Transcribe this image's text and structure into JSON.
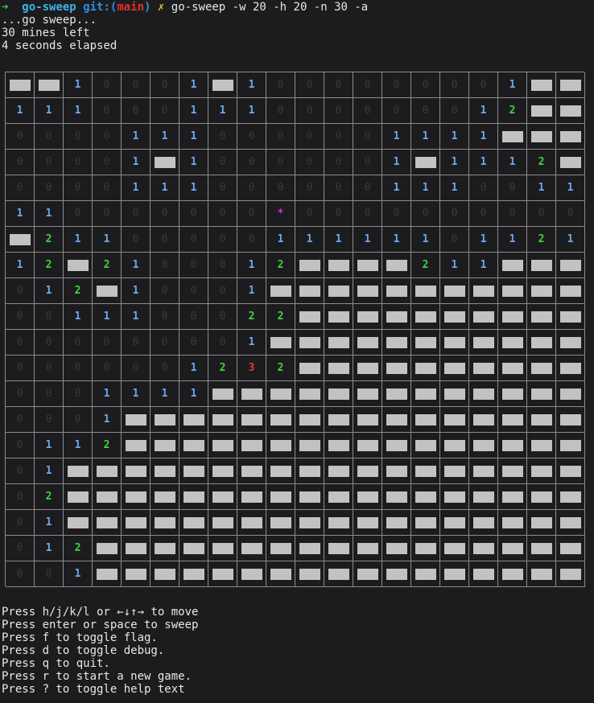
{
  "prompt": {
    "arrow": "➜",
    "directory": "go-sweep",
    "git_prefix": "git:(",
    "branch": "main",
    "git_suffix": ")",
    "dirty_mark": "✗",
    "command": "go-sweep -w 20 -h 20 -n 30 -a"
  },
  "status": {
    "title": "...go sweep...",
    "mines_left": "30 mines left",
    "elapsed": "4 seconds elapsed"
  },
  "board": {
    "width": 20,
    "height": 20,
    "legend": "# = covered cell, * = mine, digits = revealed counts",
    "rows": [
      "##100010#10000000010##",
      "11100011100000000012##",
      "00001110000001111###",
      "00001#1000000#1#1112#",
      "00001110000001110011",
      "1100000000*000000000",
      "#211000001111110112 1",
      "12#210001 2####211###",
      "012#1000 1##########",
      "00111000 22#########",
      "0000000001##########",
      "0000001231 2#########",
      "0001111###########",
      "0001################",
      "0112################",
      "01##################",
      "02##################",
      "01##################",
      "012#################",
      "001#################"
    ],
    "colors": {
      "one": "#6ea9ee",
      "two": "#3ed43e",
      "three": "#e23a2e",
      "zero": "#3a3a3c",
      "mine": "#d829d1",
      "covered": "#c2c2c2",
      "grid": "#8c8c8c",
      "background": "#1c1c1e"
    }
  },
  "help": [
    "Press h/j/k/l or ←↓↑→ to move",
    "Press enter or space to sweep",
    "Press f to toggle flag.",
    "Press d to toggle debug.",
    "Press q to quit.",
    "Press r to start a new game.",
    "Press ? to toggle help text"
  ]
}
